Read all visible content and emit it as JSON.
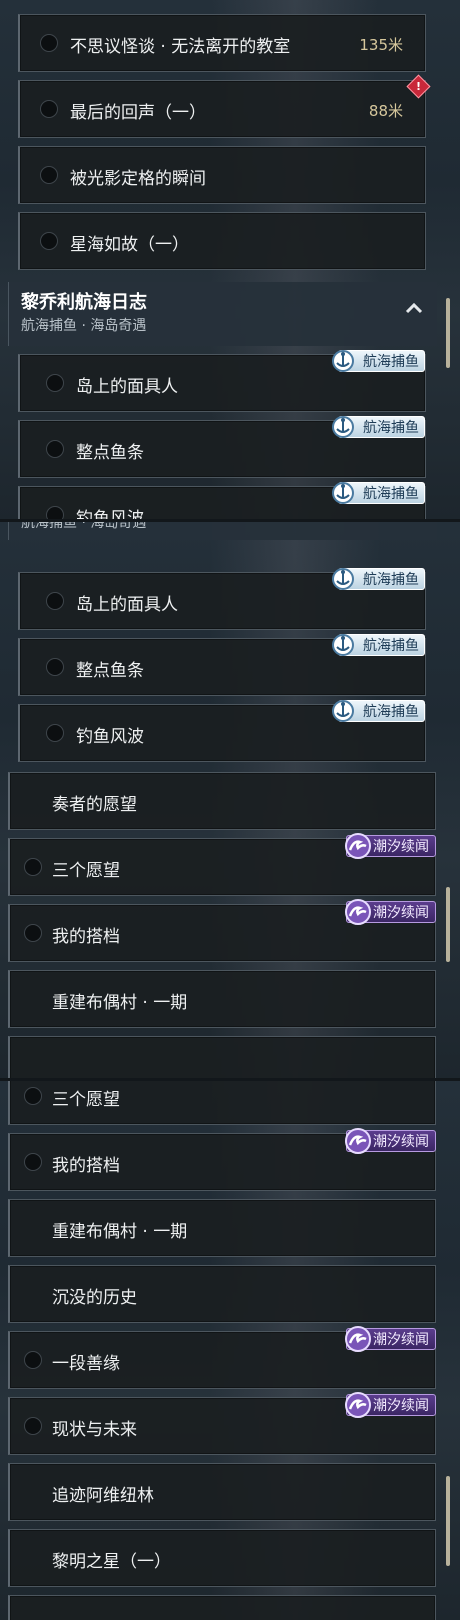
{
  "panel1": {
    "quests": [
      {
        "title": "不思议怪谈 · 无法离开的教室",
        "distance": "135米"
      },
      {
        "title": "最后的回声（一）",
        "distance": "88米",
        "alert": "!"
      },
      {
        "title": "被光影定格的瞬间"
      },
      {
        "title": "星海如故（一）"
      }
    ],
    "group": {
      "title": "黎乔利航海日志",
      "subtitle": "航海捕鱼 · 海岛奇遇"
    },
    "sub_quests": [
      {
        "title": "岛上的面具人",
        "tag": "航海捕鱼"
      },
      {
        "title": "整点鱼条",
        "tag": "航海捕鱼"
      },
      {
        "title": "钓鱼风波",
        "tag": "航海捕鱼"
      }
    ]
  },
  "panel2": {
    "group_subtitle": "航海捕鱼 · 海岛奇遇",
    "sub_quests": [
      {
        "title": "岛上的面具人",
        "tag": "航海捕鱼"
      },
      {
        "title": "整点鱼条",
        "tag": "航海捕鱼"
      },
      {
        "title": "钓鱼风波",
        "tag": "航海捕鱼"
      }
    ],
    "quests": [
      {
        "title": "奏者的愿望"
      },
      {
        "title": "三个愿望",
        "tag": "潮汐续闻"
      },
      {
        "title": "我的搭档",
        "tag": "潮汐续闻"
      },
      {
        "title": "重建布偶村 · 一期"
      }
    ]
  },
  "panel3": {
    "quests": [
      {
        "title": "三个愿望"
      },
      {
        "title": "我的搭档",
        "tag": "潮汐续闻"
      },
      {
        "title": "重建布偶村 · 一期"
      },
      {
        "title": "沉没的历史"
      },
      {
        "title": "一段善缘",
        "tag": "潮汐续闻"
      },
      {
        "title": "现状与未来",
        "tag": "潮汐续闻"
      },
      {
        "title": "追迹阿维纽林"
      },
      {
        "title": "黎明之星（一）"
      }
    ]
  },
  "icons": {
    "collapse": "chevron-up-icon",
    "fishing_tag": "fishing-boat-icon",
    "tide_tag": "wave-icon",
    "alert": "warning-diamond-icon"
  },
  "colors": {
    "fishing_tag_bg": "#d6e6f0",
    "tide_tag_bg": "#4a3178",
    "distance_text": "#d6c79c",
    "alert": "#c8283a",
    "scrollbar": "#b8b29c"
  }
}
